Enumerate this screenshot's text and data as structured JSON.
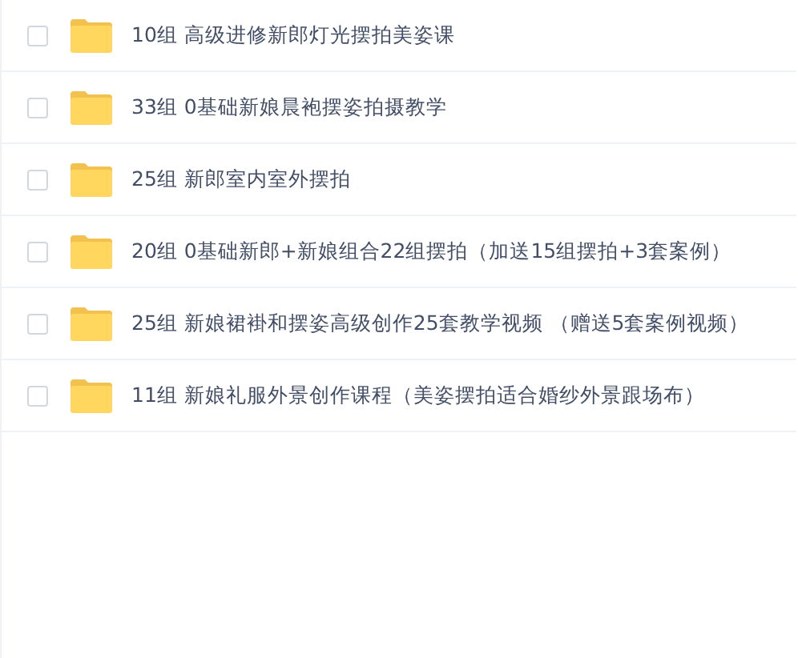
{
  "files": [
    {
      "name": "10组 高级进修新郎灯光摆拍美姿课",
      "checked": false
    },
    {
      "name": "33组 0基础新娘晨袍摆姿拍摄教学",
      "checked": false
    },
    {
      "name": "25组 新郎室内室外摆拍",
      "checked": false
    },
    {
      "name": "20组 0基础新郎+新娘组合22组摆拍（加送15组摆拍+3套案例）",
      "checked": false
    },
    {
      "name": "25组 新娘裙褂和摆姿高级创作25套教学视频 （赠送5套案例视频）",
      "checked": false
    },
    {
      "name": "11组 新娘礼服外景创作课程（美姿摆拍适合婚纱外景跟场布）",
      "checked": false
    }
  ]
}
